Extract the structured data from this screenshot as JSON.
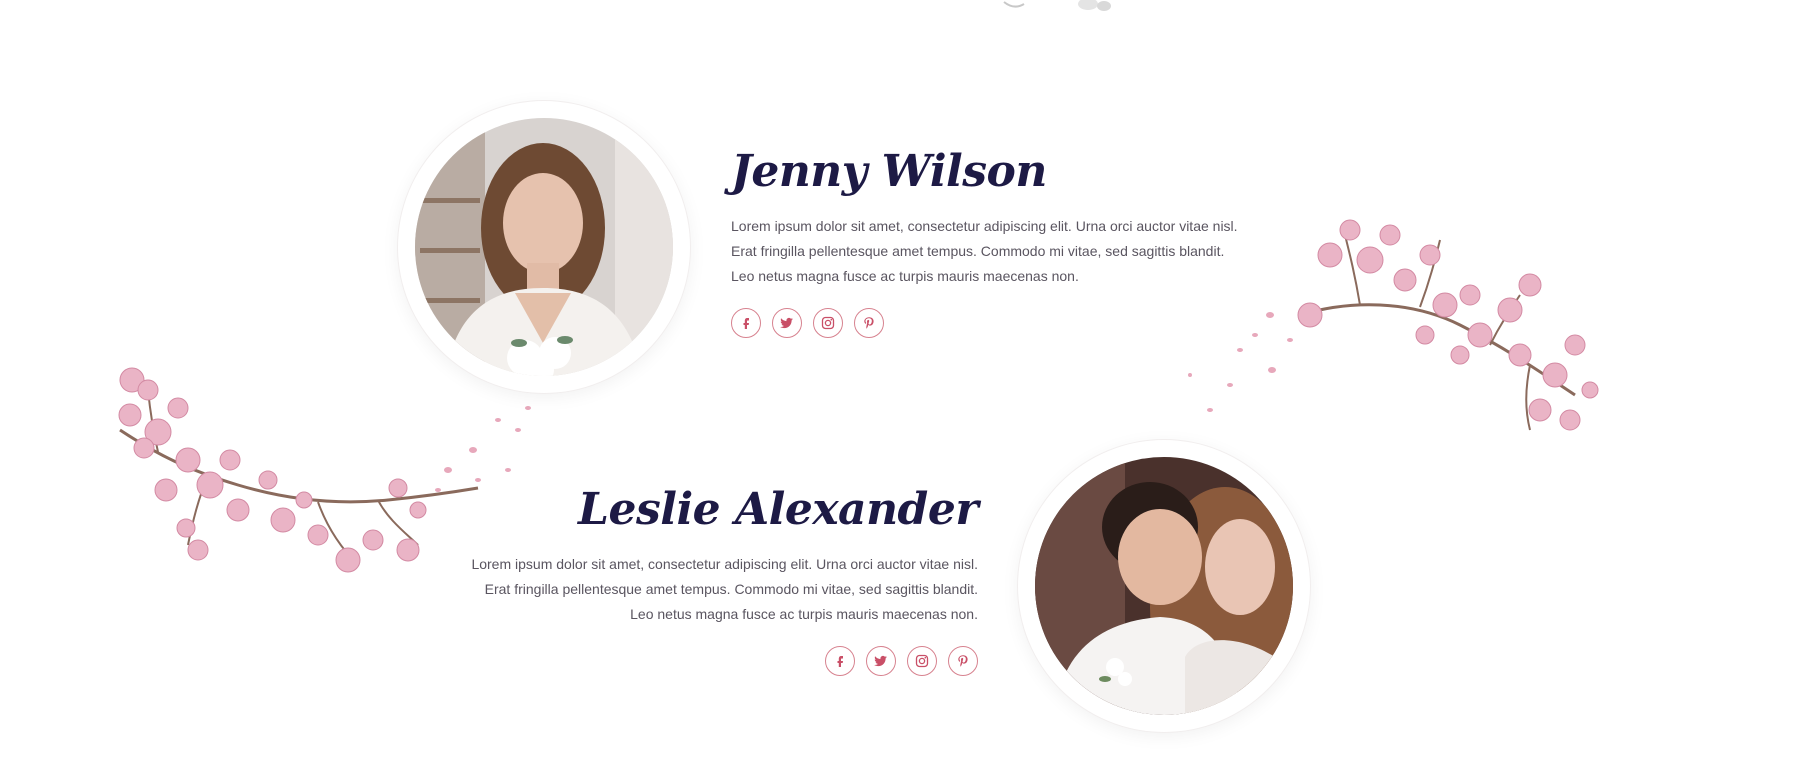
{
  "profiles": [
    {
      "name": "Jenny Wilson",
      "bio": "Lorem ipsum dolor sit amet, consectetur adipiscing elit. Urna orci auctor vitae nisl. Erat fringilla pellentesque amet tempus. Commodo mi vitae, sed sagittis blandit. Leo netus magna fusce ac turpis mauris maecenas non.",
      "photo_icon": "bride-portrait",
      "social": [
        "facebook-icon",
        "twitter-icon",
        "instagram-icon",
        "pinterest-icon"
      ]
    },
    {
      "name": "Leslie Alexander",
      "bio": "Lorem ipsum dolor sit amet, consectetur adipiscing elit. Urna orci auctor vitae nisl. Erat fringilla pellentesque amet tempus. Commodo mi vitae, sed sagittis blandit. Leo netus magna fusce ac turpis mauris maecenas non.",
      "photo_icon": "couple-portrait",
      "social": [
        "facebook-icon",
        "twitter-icon",
        "instagram-icon",
        "pinterest-icon"
      ]
    }
  ],
  "colors": {
    "name_text": "#1d1a45",
    "body_text": "#5a5560",
    "social_accent": "#c94f67",
    "social_border": "#d7828f",
    "blossom": "#e6a9bd",
    "branch": "#8a6a5c"
  }
}
